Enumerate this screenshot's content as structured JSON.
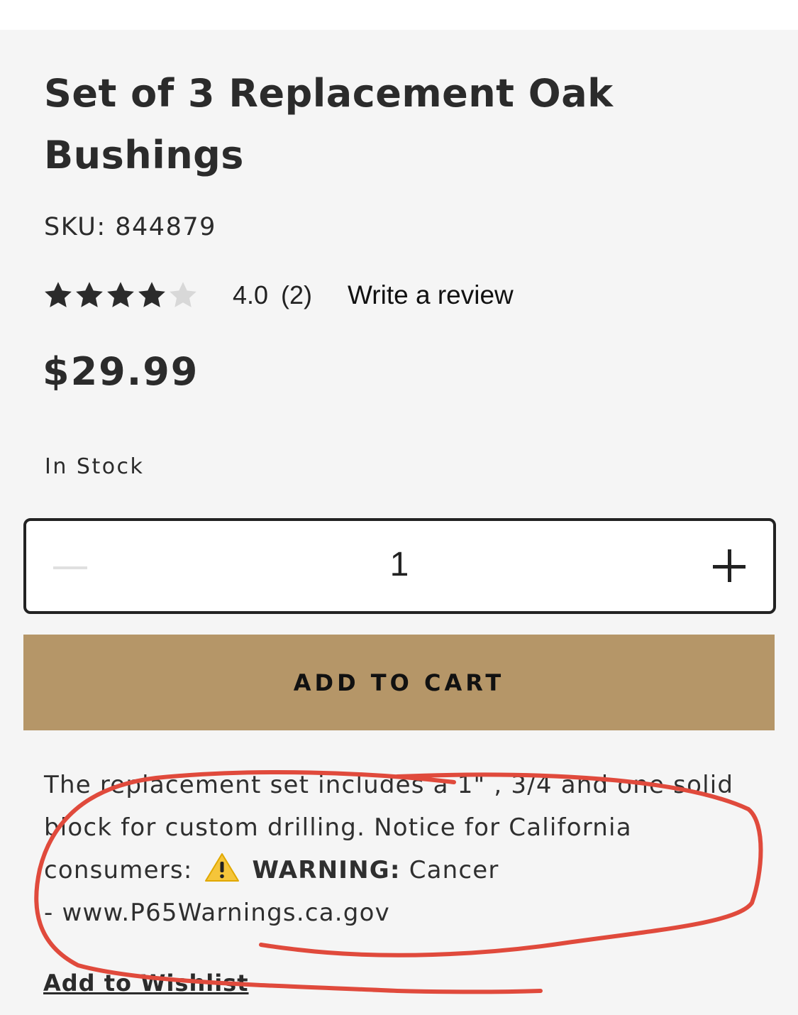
{
  "product": {
    "title_line1": "Set of 3 Replacement Oak",
    "title_line2": "Bushings",
    "sku": "SKU: 844879",
    "rating": {
      "stars_filled": 4,
      "stars_total": 5,
      "value": "4.0",
      "count": "(2)",
      "write_review_label": "Write a review"
    },
    "price": "$29.99",
    "stock_status": "In Stock"
  },
  "quantity": {
    "value": "1"
  },
  "cart": {
    "add_label": "ADD TO CART"
  },
  "description": {
    "line1": "The replacement set includes a 1\" , 3/4 and one solid",
    "line2": "block for custom drilling. Notice for California",
    "line3_prefix": "consumers:",
    "warning_label": "WARNING:",
    "warning_text": "Cancer",
    "line4": "- www.P65Warnings.ca.gov"
  },
  "wishlist": {
    "label": "Add to Wishlist"
  },
  "colors": {
    "accent": "#b59668",
    "annotation": "#e04a3c",
    "star_filled": "#2b2b2b",
    "star_empty": "#d8d8d8",
    "warning_icon": "#f5c53a"
  },
  "icons": {
    "minus": "minus-icon",
    "plus": "plus-icon",
    "warning": "warning-icon",
    "star": "star-icon"
  }
}
